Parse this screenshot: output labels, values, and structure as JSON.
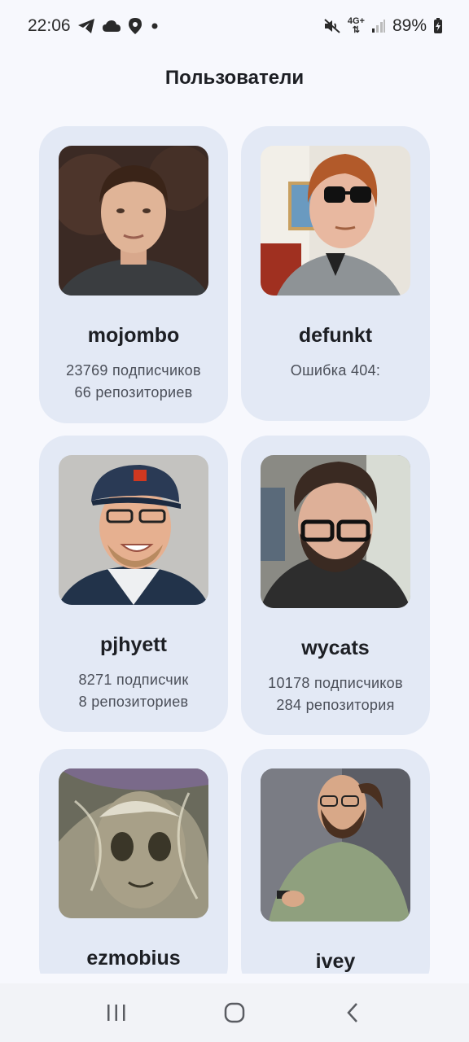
{
  "status_bar": {
    "time": "22:06",
    "network": "4G+",
    "battery": "89%",
    "icons": [
      "telegram-icon",
      "cloud-icon",
      "location-icon",
      "dot-icon",
      "mute-icon",
      "signal-icon",
      "battery-icon"
    ]
  },
  "page": {
    "title": "Пользователи"
  },
  "users": [
    {
      "login": "mojombo",
      "followers": "23769 подписчиков",
      "repos": "66 репозиториев"
    },
    {
      "login": "defunkt",
      "followers": "Ошибка 404:",
      "repos": ""
    },
    {
      "login": "pjhyett",
      "followers": "8271 подписчик",
      "repos": "8 репозиториев"
    },
    {
      "login": "wycats",
      "followers": "10178 подписчиков",
      "repos": "284 репозитория"
    },
    {
      "login": "ezmobius",
      "followers": "",
      "repos": ""
    },
    {
      "login": "ivey",
      "followers": "",
      "repos": ""
    }
  ],
  "nav_bar": {
    "icons": [
      "recent-apps-icon",
      "home-icon",
      "back-icon"
    ]
  },
  "colors": {
    "background": "#f7f8fd",
    "card": "#e3e9f5",
    "text": "#1d1f24",
    "secondary_text": "#4a4e58"
  }
}
